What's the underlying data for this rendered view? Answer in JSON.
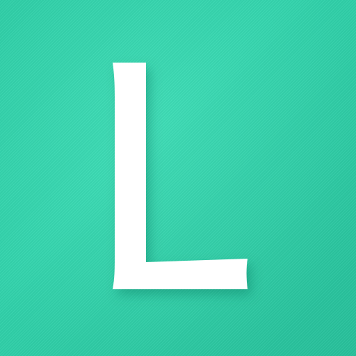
{
  "app_icon": {
    "letter": "L",
    "background_color": "#33d9b0",
    "letter_color": "#ffffff"
  }
}
